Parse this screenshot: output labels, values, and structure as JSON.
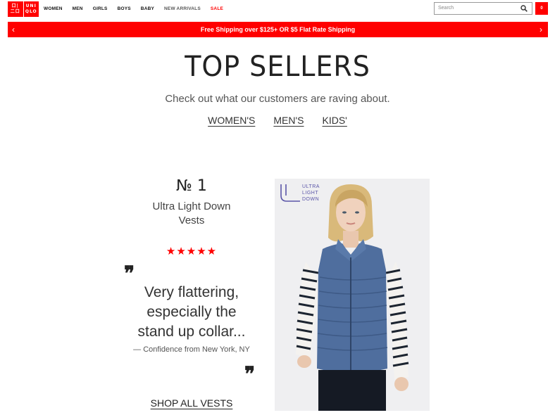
{
  "header": {
    "logo": {
      "line1": "UNI",
      "line2": "QLO",
      "color": "#ff0000"
    },
    "nav": [
      "WOMEN",
      "MEN",
      "GIRLS",
      "BOYS",
      "BABY",
      "NEW ARRIVALS",
      "SALE"
    ],
    "search": {
      "placeholder": "Search",
      "icon": "search-icon"
    },
    "cart": {
      "count": "0",
      "icon": "cart-icon"
    }
  },
  "banner": {
    "text": "Free Shipping over $125+ OR $5 Flat Rate Shipping",
    "prev": "‹",
    "next": "›",
    "color": "#ff0000"
  },
  "top_sellers": {
    "title": "TOP SELLERS",
    "subtitle": "Check out what our customers are raving about.",
    "tabs": [
      "WOMEN'S",
      "MEN'S",
      "KIDS'"
    ]
  },
  "feature": {
    "rank": "№ 1",
    "product_name_line1": "Ultra Light Down",
    "product_name_line2": "Vests",
    "rating_stars": 5,
    "stars": "★★★★★",
    "quote_open": "❞",
    "quote_close": "❞",
    "review_line1": "Very flattering,",
    "review_line2": "especially the",
    "review_line3": "stand up collar...",
    "reviewer": "— Confidence from New York, NY",
    "shop_link": "SHOP ALL VESTS",
    "image_badge": {
      "line1": "ULTRA",
      "line2": "LIGHT",
      "line3": "DOWN"
    }
  }
}
